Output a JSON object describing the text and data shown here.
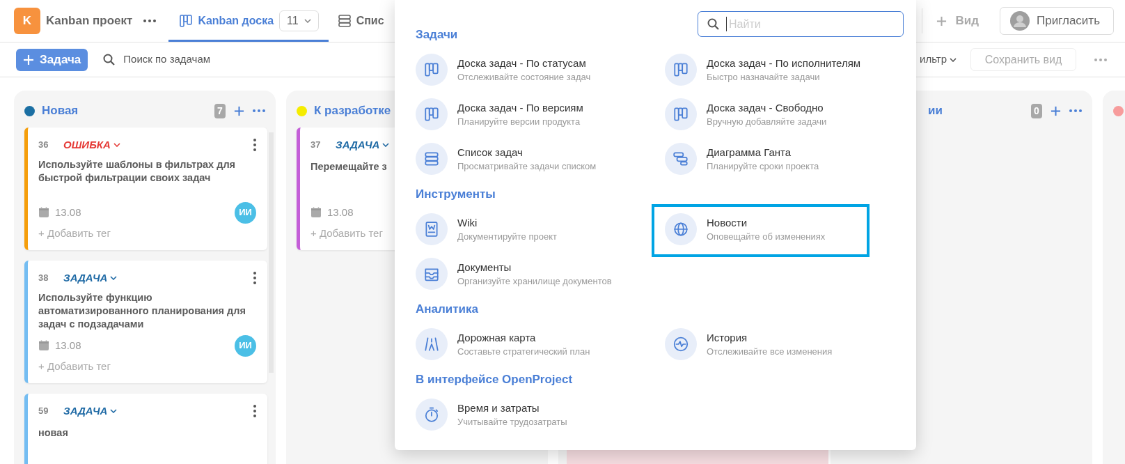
{
  "project": {
    "initial": "K",
    "name": "Kanban проект"
  },
  "tabs": [
    {
      "label": "Kanban доска",
      "selected": true,
      "count": "11"
    },
    {
      "label": "Спис",
      "selected": false
    }
  ],
  "add_view": "Вид",
  "invite": "Пригласить",
  "toolbar": {
    "new_task": "Задача",
    "search_placeholder": "Поиск по задачам",
    "filter": "ильтр",
    "save_view": "Сохранить вид"
  },
  "columns": [
    {
      "title": "Новая",
      "color": "#1b6fa3",
      "count": "7",
      "cards": [
        {
          "kind": "bug",
          "color": "#f59e0b",
          "number": "36",
          "type": "ОШИБКА",
          "title": "Используйте шаблоны в фильтрах для быстрой фильтрации своих задач",
          "date": "13.08",
          "assignee": "ИИ",
          "add_tag": "+ Добавить тег",
          "has_menu": true
        },
        {
          "kind": "task",
          "color": "#74bdf2",
          "number": "38",
          "type": "ЗАДАЧА",
          "title": "Используйте функцию автоматизированного планирования для задач с подзадачами",
          "date": "13.08",
          "assignee": "ИИ",
          "add_tag": "+ Добавить тег",
          "has_menu": true
        },
        {
          "kind": "task",
          "color": "#74bdf2",
          "number": "59",
          "type": "ЗАДАЧА",
          "title": "новая",
          "has_menu": true
        }
      ]
    },
    {
      "title": "К разработке",
      "color": "#f5ec00",
      "cards": [
        {
          "kind": "task",
          "color": "#c45ed8",
          "number": "37",
          "type": "ЗАДАЧА",
          "title": "Перемещайте з",
          "date": "13.08",
          "add_tag": "+ Добавить тег",
          "has_menu": false
        }
      ]
    },
    {
      "cards": [
        {
          "kind": "ghost",
          "color": "#f6dde1"
        }
      ]
    },
    {
      "title": "ии",
      "count": "0"
    },
    {
      "color": "#f79c9c"
    }
  ],
  "menu": {
    "search_placeholder": "Найти",
    "sections": [
      {
        "title": "Задачи",
        "items": [
          {
            "kind": "board",
            "title": "Доска задач - По статусам",
            "subtitle": "Отслеживайте состояние задач",
            "highlighted": false
          },
          {
            "kind": "board",
            "title": "Доска задач - По исполнителям",
            "subtitle": "Быстро назначайте задачи",
            "highlighted": false
          },
          {
            "kind": "board",
            "title": "Доска задач - По версиям",
            "subtitle": "Планируйте версии продукта",
            "highlighted": false
          },
          {
            "kind": "board",
            "title": "Доска задач - Свободно",
            "subtitle": "Вручную добавляйте задачи",
            "highlighted": false
          },
          {
            "kind": "list",
            "title": "Список задач",
            "subtitle": "Просматривайте задачи списком",
            "highlighted": false
          },
          {
            "kind": "gantt",
            "title": "Диаграмма Ганта",
            "subtitle": "Планируйте сроки проекта",
            "highlighted": false
          }
        ]
      },
      {
        "title": "Инструменты",
        "items": [
          {
            "kind": "wiki",
            "title": "Wiki",
            "subtitle": "Документируйте проект",
            "highlighted": false
          },
          {
            "kind": "news",
            "title": "Новости",
            "subtitle": "Оповещайте об изменениях",
            "highlighted": true
          },
          {
            "kind": "docs",
            "title": "Документы",
            "subtitle": "Организуйте хранилище документов",
            "highlighted": false
          }
        ]
      },
      {
        "title": "Аналитика",
        "items": [
          {
            "kind": "roadmap",
            "title": "Дорожная карта",
            "subtitle": "Составьте стратегический план",
            "highlighted": false
          },
          {
            "kind": "history",
            "title": "История",
            "subtitle": "Отслеживайте все изменения",
            "highlighted": false
          }
        ]
      },
      {
        "title": "В интерфейсе OpenProject",
        "items": [
          {
            "kind": "time",
            "title": "Время и затраты",
            "subtitle": "Учитывайте трудозатраты",
            "highlighted": false
          }
        ]
      }
    ]
  }
}
